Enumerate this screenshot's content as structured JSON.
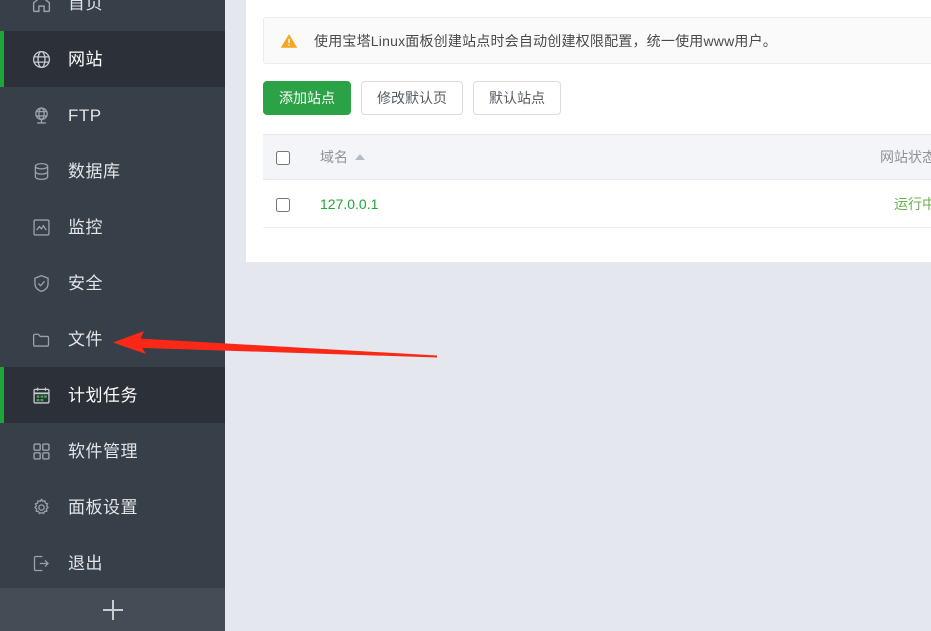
{
  "sidebar": {
    "items": [
      {
        "label": "首页",
        "icon": "home-icon",
        "active": false,
        "partial": true
      },
      {
        "label": "网站",
        "icon": "globe-icon",
        "active": true,
        "partial": false
      },
      {
        "label": "FTP",
        "icon": "ftp-icon",
        "active": false,
        "partial": false
      },
      {
        "label": "数据库",
        "icon": "database-icon",
        "active": false,
        "partial": false
      },
      {
        "label": "监控",
        "icon": "monitor-chart-icon",
        "active": false,
        "partial": false
      },
      {
        "label": "安全",
        "icon": "shield-check-icon",
        "active": false,
        "partial": false
      },
      {
        "label": "文件",
        "icon": "folder-icon",
        "active": false,
        "partial": false
      },
      {
        "label": "计划任务",
        "icon": "calendar-icon",
        "active": true,
        "partial": false
      },
      {
        "label": "软件管理",
        "icon": "grid-apps-icon",
        "active": false,
        "partial": false
      },
      {
        "label": "面板设置",
        "icon": "gear-icon",
        "active": false,
        "partial": false
      },
      {
        "label": "退出",
        "icon": "logout-icon",
        "active": false,
        "partial": false
      }
    ],
    "footer": {
      "icon": "plus-icon"
    }
  },
  "main": {
    "alert": {
      "icon": "warning-triangle-icon",
      "text": "使用宝塔Linux面板创建站点时会自动创建权限配置，统一使用www用户。"
    },
    "toolbar": {
      "add_site_label": "添加站点",
      "edit_default_page_label": "修改默认页",
      "default_site_label": "默认站点"
    },
    "table": {
      "columns": [
        {
          "key": "check",
          "label": "",
          "sort": false
        },
        {
          "key": "domain",
          "label": "域名",
          "sort": true,
          "sort_icon": "sort-asc-icon"
        },
        {
          "key": "status",
          "label": "网站状态",
          "sort": true,
          "sort_icon": "sort-asc-icon"
        }
      ],
      "rows": [
        {
          "domain": "127.0.0.1",
          "status": "运行中",
          "status_icon": "play-icon",
          "checked": false
        }
      ]
    }
  },
  "annotation": {
    "arrow": {
      "color": "#fb2818",
      "points": "from (437,357) to (113,342)",
      "icon": "arrow-left-icon"
    }
  },
  "colors": {
    "sidebar_bg": "#373f48",
    "sidebar_active_bg": "#2c3139",
    "accent_green": "#20a53a",
    "page_bg": "#e4e7ed",
    "warning_orange": "#f5a623",
    "annotation_red": "#fb2818"
  }
}
